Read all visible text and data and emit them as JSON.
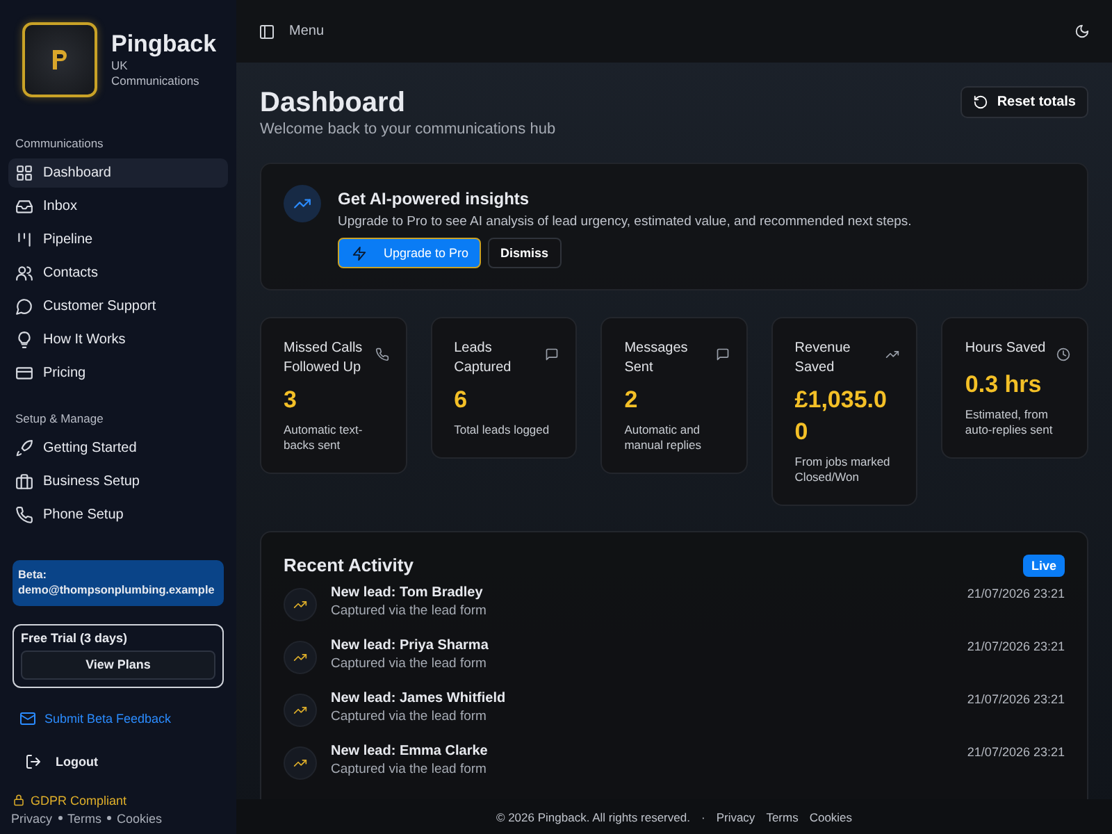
{
  "sidebar": {
    "brand": {
      "name": "Pingback",
      "subtitle": "UK Communications"
    },
    "sections": [
      {
        "label": "Communications",
        "items": [
          {
            "label": "Dashboard",
            "selected": true
          },
          {
            "label": "Inbox",
            "selected": false
          },
          {
            "label": "Pipeline",
            "selected": false
          },
          {
            "label": "Contacts",
            "selected": false
          },
          {
            "label": "Customer Support",
            "selected": false
          },
          {
            "label": "How It Works",
            "selected": false
          },
          {
            "label": "Pricing",
            "selected": false
          }
        ]
      },
      {
        "label": "Setup & Manage",
        "items": [
          {
            "label": "Getting Started",
            "selected": false
          },
          {
            "label": "Business Setup",
            "selected": false
          },
          {
            "label": "Phone Setup",
            "selected": false
          }
        ]
      }
    ],
    "beta_notice": "Beta: demo@thompsonplumbing.example",
    "trial": {
      "label": "Free Trial (3 days)",
      "button": "View Plans"
    },
    "feedback_link": "Submit Beta Feedback",
    "logout": "Logout",
    "compliance": "GDPR Compliant",
    "legal_links": [
      "Privacy",
      "Terms",
      "Cookies"
    ]
  },
  "topbar": {
    "menu": "Menu"
  },
  "header": {
    "title": "Dashboard",
    "subtitle": "Welcome back to your communications hub",
    "button": "Reset totals"
  },
  "insight": {
    "title": "Get AI-powered insights",
    "text": "Upgrade to Pro to see AI analysis of lead urgency, estimated value, and recommended next steps.",
    "primary": "Upgrade to Pro",
    "secondary": "Dismiss"
  },
  "stats": [
    {
      "label": "Missed Calls Followed Up",
      "value": "3",
      "note": "Automatic text-backs sent"
    },
    {
      "label": "Leads Captured",
      "value": "6",
      "note": "Total leads logged"
    },
    {
      "label": "Messages Sent",
      "value": "2",
      "note": "Automatic and manual replies"
    },
    {
      "label": "Revenue Saved",
      "value": "£1,035.00",
      "note": "From jobs marked Closed/Won"
    },
    {
      "label": "Hours Saved",
      "value": "0.3 hrs",
      "note": "Estimated, from auto-replies sent"
    }
  ],
  "activity": {
    "title": "Recent Activity",
    "badge": "Live",
    "items": [
      {
        "title": "New lead: Tom Bradley",
        "detail": "Captured via the lead form",
        "time": "21/07/2026 23:21"
      },
      {
        "title": "New lead: Priya Sharma",
        "detail": "Captured via the lead form",
        "time": "21/07/2026 23:21"
      },
      {
        "title": "New lead: James Whitfield",
        "detail": "Captured via the lead form",
        "time": "21/07/2026 23:21"
      },
      {
        "title": "New lead: Emma Clarke",
        "detail": "Captured via the lead form",
        "time": "21/07/2026 23:21"
      }
    ]
  },
  "footer": {
    "copyright": "© 2026 Pingback. All rights reserved.",
    "separator": "·",
    "links": [
      "Privacy",
      "Terms",
      "Cookies"
    ]
  }
}
